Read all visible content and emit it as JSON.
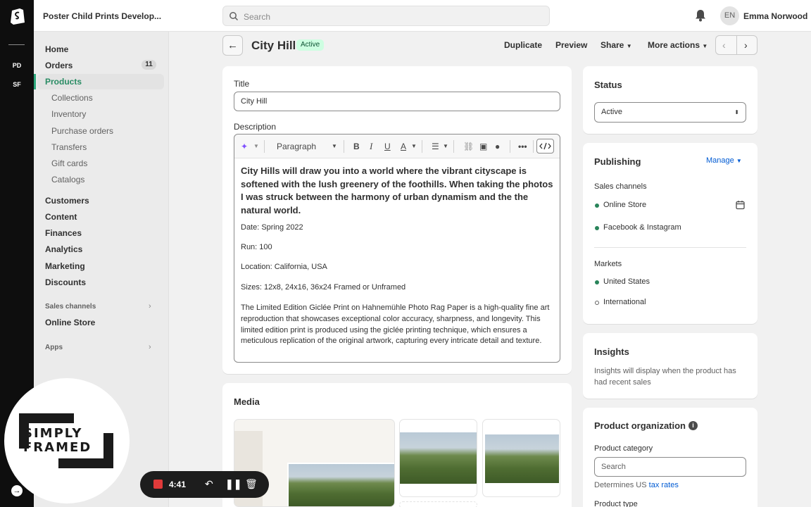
{
  "topbar": {
    "store_name": "Poster Child Prints Develop...",
    "search_placeholder": "Search",
    "user_initials": "EN",
    "user_name": "Emma Norwood"
  },
  "rail": {
    "stores": [
      "PD",
      "SF"
    ]
  },
  "sidebar": {
    "home": "Home",
    "orders": "Orders",
    "orders_count": "11",
    "products": "Products",
    "collections": "Collections",
    "inventory": "Inventory",
    "purchase_orders": "Purchase orders",
    "transfers": "Transfers",
    "gift_cards": "Gift cards",
    "catalogs": "Catalogs",
    "customers": "Customers",
    "content": "Content",
    "finances": "Finances",
    "analytics": "Analytics",
    "marketing": "Marketing",
    "discounts": "Discounts",
    "sales_channels": "Sales channels",
    "online_store": "Online Store",
    "apps": "Apps"
  },
  "header": {
    "title": "City Hill",
    "status": "Active",
    "duplicate": "Duplicate",
    "preview": "Preview",
    "share": "Share",
    "more_actions": "More actions"
  },
  "product": {
    "title_label": "Title",
    "title_value": "City Hill",
    "description_label": "Description",
    "paragraph_style": "Paragraph",
    "lead": "City Hills will draw you into a world where the vibrant cityscape is softened with the lush greenery of the foothills. When taking the photos I was struck between the harmony of urban dynamism and the the natural world.",
    "date": "Date: Spring 2022",
    "run": "Run: 100",
    "location": "Location: California, USA",
    "sizes": "Sizes: 12x8, 24x16, 36x24 Framed or Unframed",
    "paragraph": "The Limited Edition Giclée Print on Hahnemühle Photo Rag Paper is a high-quality fine art reproduction that showcases exceptional color accuracy, sharpness, and longevity. This limited edition print is produced using the giclée printing technique, which ensures a meticulous replication of the original artwork, capturing every intricate detail and texture.",
    "media_label": "Media"
  },
  "status_card": {
    "title": "Status",
    "value": "Active"
  },
  "publishing": {
    "title": "Publishing",
    "manage": "Manage",
    "sales_channels_label": "Sales channels",
    "channel_1": "Online Store",
    "channel_2": "Facebook & Instagram",
    "markets_label": "Markets",
    "market_1": "United States",
    "market_2": "International"
  },
  "insights": {
    "title": "Insights",
    "text": "Insights will display when the product has had recent sales"
  },
  "organization": {
    "title": "Product organization",
    "category_label": "Product category",
    "category_placeholder": "Search",
    "determines": "Determines US",
    "tax_rates": "tax rates",
    "product_type": "Product type"
  },
  "overlay": {
    "brand_line1": "SIMPLY",
    "brand_line2": "FRAMED",
    "rec_time": "4:41"
  },
  "colors": {
    "accent": "#2ea97d",
    "link": "#005bd3",
    "badge_bg": "#cdfee1"
  }
}
